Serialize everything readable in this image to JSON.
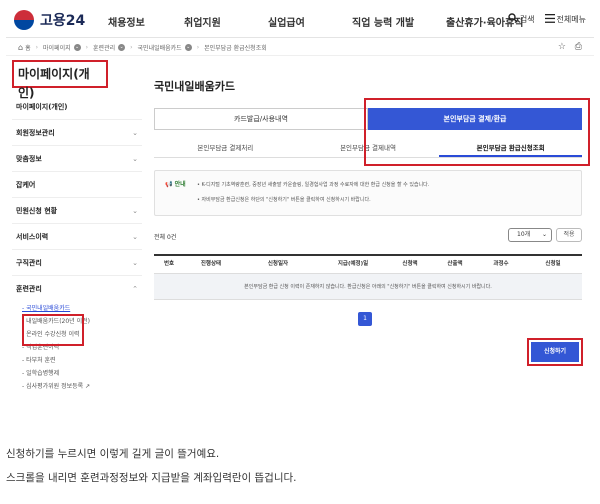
{
  "header": {
    "logo_text": "고용24",
    "menu": [
      "채용정보",
      "취업지원",
      "실업급여",
      "직업 능력 개발",
      "출산휴가·육아휴직"
    ],
    "search_label": "검색",
    "all_menu_label": "전체메뉴"
  },
  "breadcrumb": [
    "홈",
    "마이페이지",
    "훈련관리",
    "국민내일배움카드",
    "본인부담금 환급신청조회"
  ],
  "sidebar": {
    "title": "마이페이지(개인)",
    "items": [
      {
        "label": "마이페이지(개인)",
        "chev": ""
      },
      {
        "label": "회원정보관리",
        "chev": "⌄"
      },
      {
        "label": "맞춤정보",
        "chev": "⌄"
      },
      {
        "label": "잡케어",
        "chev": ""
      },
      {
        "label": "민원신청 현황",
        "chev": "⌄"
      },
      {
        "label": "서비스이력",
        "chev": "⌄"
      },
      {
        "label": "구직관리",
        "chev": "⌄"
      },
      {
        "label": "훈련관리",
        "chev": "⌃"
      }
    ],
    "sub_items": [
      "- 국민내일배움카드",
      "- 내일배움카드(20년 이전)",
      "- 온라인 수강신청 이력",
      "- 직업훈련이력",
      "- 타부처 훈련",
      "- 일학습병행제",
      "- 심사평가위원 정보등록 ↗"
    ]
  },
  "main": {
    "title": "국민내일배움카드",
    "tabs": [
      "카드발급/사용내역",
      "본인부담금 결제/환급"
    ],
    "subtabs": [
      "본인부담금 결제처리",
      "본인부담금 결제내역",
      "본인부담금 환급신청조회"
    ],
    "notice_label": "안내",
    "notice_lines": [
      "• K-디지털 기초역량훈련, 중장년 새출발 카운슬링, 일경험사업 과정 수료자에 대한 환급 신청을 할 수 있습니다.",
      "• 자비부담금 환급신청은 하단의 \"신청하기\" 버튼을 클릭하여 신청하시기 바랍니다."
    ],
    "count_text": "전체 0건",
    "page_size": "10개",
    "apply_label": "적용",
    "columns": [
      "번호",
      "진행상태",
      "신청일자",
      "지급(예정)일",
      "신청액",
      "산출액",
      "과정수",
      "신청일"
    ],
    "empty_text": "본인부담금 환급 신청 이력이 존재하지 않습니다. 환급신청은 아래의 \"신청하기\" 버튼을 클릭하여 신청하시기 바랍니다.",
    "page": "1",
    "apply_button": "신청하기"
  },
  "caption": [
    "신청하기를 누르시면 이렇게 길게 글이 뜰거예요.",
    "스크롤을 내리면 훈련과정정보와 지급받을 계좌입력란이 뜹겁니다."
  ],
  "colors": {
    "accent": "#3457d5",
    "highlight": "#d0202a"
  }
}
